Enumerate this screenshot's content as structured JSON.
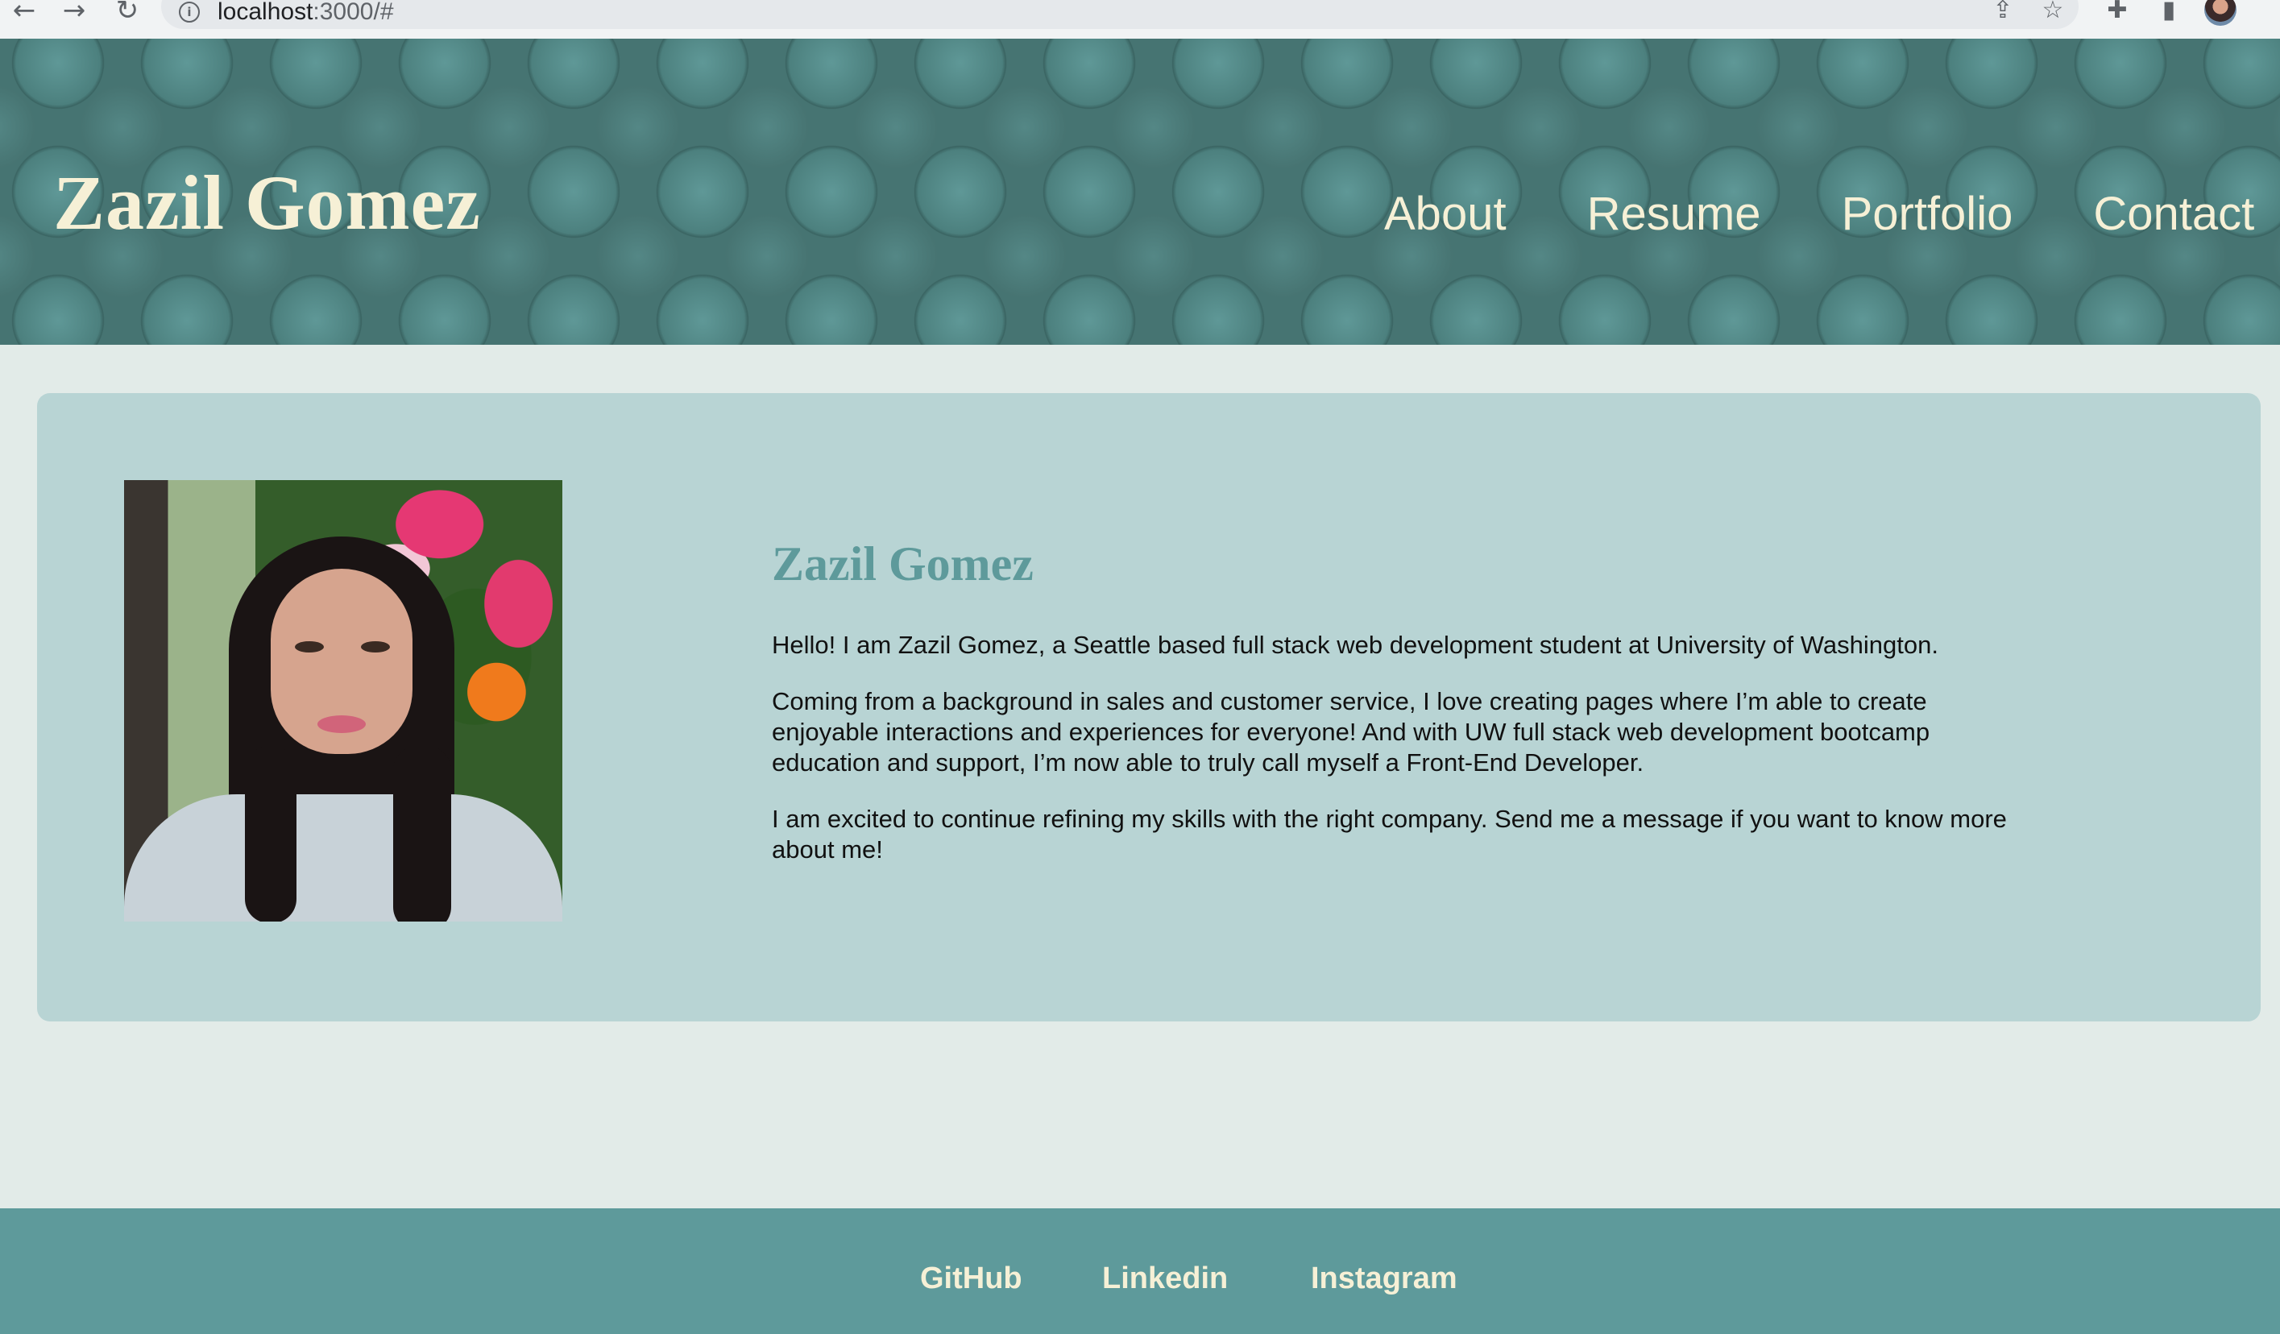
{
  "browser": {
    "url_host": "localhost",
    "url_rest": ":3000/#",
    "back_icon": "arrow-left-icon",
    "forward_icon": "arrow-right-icon",
    "reload_icon": "reload-icon"
  },
  "header": {
    "brand": "Zazil Gomez",
    "nav": [
      "About",
      "Resume",
      "Portfolio",
      "Contact"
    ]
  },
  "about": {
    "title": "Zazil Gomez",
    "paragraphs": [
      "Hello! I am Zazil Gomez, a Seattle based full stack web development student at University of Washington.",
      "Coming from a background in sales and customer service, I love creating pages where I’m able to create enjoyable interactions and experiences for everyone! And with UW full stack web development bootcamp education and support, I’m now able to truly call myself a Front-End Developer.",
      "I am excited to continue refining my skills with the right company. Send me a message if you want to know more about me!"
    ]
  },
  "footer": {
    "links": [
      "GitHub",
      "Linkedin",
      "Instagram"
    ]
  },
  "colors": {
    "header_bg": "#467472",
    "cream": "#f6f0d6",
    "card_bg": "#b8d4d4",
    "accent": "#5e9a9b",
    "page_bg": "#e2ebe8"
  }
}
